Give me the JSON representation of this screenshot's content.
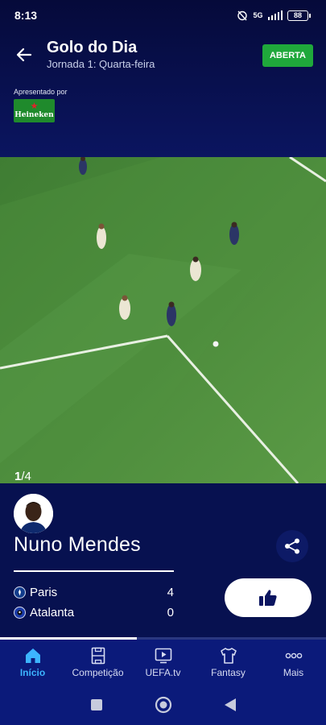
{
  "status_bar": {
    "time": "8:13",
    "network": "5G",
    "battery": "88"
  },
  "header": {
    "title": "Golo do Dia",
    "subtitle": "Jornada 1: Quarta-feira",
    "badge": "ABERTA"
  },
  "sponsor": {
    "label": "Apresentado por",
    "brand": "Heineken"
  },
  "video": {
    "position": "1",
    "total": "/4",
    "progress": 0.42
  },
  "player": {
    "name": "Nuno Mendes",
    "teams": [
      {
        "name": "Paris",
        "score": "4",
        "color": "#123c8c"
      },
      {
        "name": "Atalanta",
        "score": "0",
        "color": "#1a3aa8"
      }
    ]
  },
  "bottom_nav": [
    {
      "label": "Início",
      "icon": "home-icon",
      "active": true
    },
    {
      "label": "Competição",
      "icon": "pitch-icon",
      "active": false
    },
    {
      "label": "UEFA.tv",
      "icon": "play-screen-icon",
      "active": false
    },
    {
      "label": "Fantasy",
      "icon": "jersey-icon",
      "active": false
    },
    {
      "label": "Mais",
      "icon": "more-icon",
      "active": false
    }
  ],
  "colors": {
    "accent": "#3cb4ff",
    "badge": "#1fa83b",
    "background": "#071150"
  }
}
